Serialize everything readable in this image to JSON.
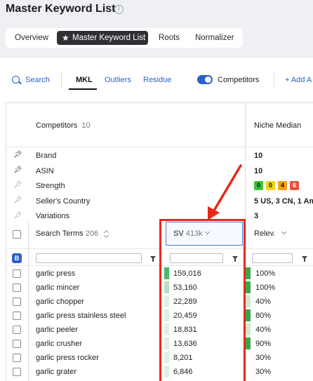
{
  "header": {
    "title": "Master Keyword List",
    "info_icon": "i"
  },
  "tabs": [
    {
      "label": "Overview",
      "active": false
    },
    {
      "label": "Master Keyword List",
      "active": true
    },
    {
      "label": "Roots",
      "active": false
    },
    {
      "label": "Normalizer",
      "active": false
    }
  ],
  "toolbar": {
    "search": "Search",
    "mkl": "MKL",
    "outliers": "Outliers",
    "residue": "Residue",
    "competitors_toggle": "Competitors",
    "add": "+ Add A"
  },
  "table": {
    "competitors_label": "Competitors",
    "competitors_count": "10",
    "niche_median": "Niche Median",
    "attribute_rows": [
      {
        "label": "Brand",
        "value": "10",
        "pinned": true
      },
      {
        "label": "ASIN",
        "value": "10",
        "pinned": true
      },
      {
        "label": "Strength",
        "value": "",
        "pinned": false
      },
      {
        "label": "Seller's Country",
        "value": "5 US, 3 CN, 1 Am",
        "pinned": false
      },
      {
        "label": "Variations",
        "value": "3",
        "pinned": false
      }
    ],
    "strength_badges": [
      {
        "value": "0",
        "color": "#3cc33c"
      },
      {
        "value": "0",
        "color": "#f2d21b"
      },
      {
        "value": "4",
        "color": "#f5a01a"
      },
      {
        "value": "6",
        "color": "#e8523a"
      }
    ],
    "search_terms_label": "Search Terms",
    "search_terms_count": "206",
    "sv_label": "SV",
    "sv_total": "413k",
    "relevance_label": "Relev.",
    "filter_badge": "B",
    "rows": [
      {
        "term": "garlic press",
        "sv": "159,016",
        "sv_level": 1.0,
        "relevance": "100%"
      },
      {
        "term": "garlic mincer",
        "sv": "53,160",
        "sv_level": 0.6,
        "relevance": "100%"
      },
      {
        "term": "garlic chopper",
        "sv": "22,289",
        "sv_level": 0.35,
        "relevance": "40%"
      },
      {
        "term": "garlic press stainless steel",
        "sv": "20,459",
        "sv_level": 0.3,
        "relevance": "80%"
      },
      {
        "term": "garlic peeler",
        "sv": "18,831",
        "sv_level": 0.28,
        "relevance": "40%"
      },
      {
        "term": "garlic crusher",
        "sv": "13,636",
        "sv_level": 0.2,
        "relevance": "90%"
      },
      {
        "term": "garlic press rocker",
        "sv": "8,201",
        "sv_level": 0.12,
        "relevance": "30%"
      },
      {
        "term": "garlic grater",
        "sv": "6,846",
        "sv_level": 0.1,
        "relevance": "30%"
      }
    ]
  },
  "colors": {
    "accent": "#2b62c9",
    "highlight": "#e8281a",
    "sv_bar": "#4cb86a",
    "relevance_bar": "#3aa84a"
  },
  "icons": [
    "info-icon",
    "star-icon",
    "search-icon",
    "toggle",
    "pin-icon",
    "checkbox",
    "sort-icon",
    "funnel-icon",
    "chevron-down-icon"
  ]
}
